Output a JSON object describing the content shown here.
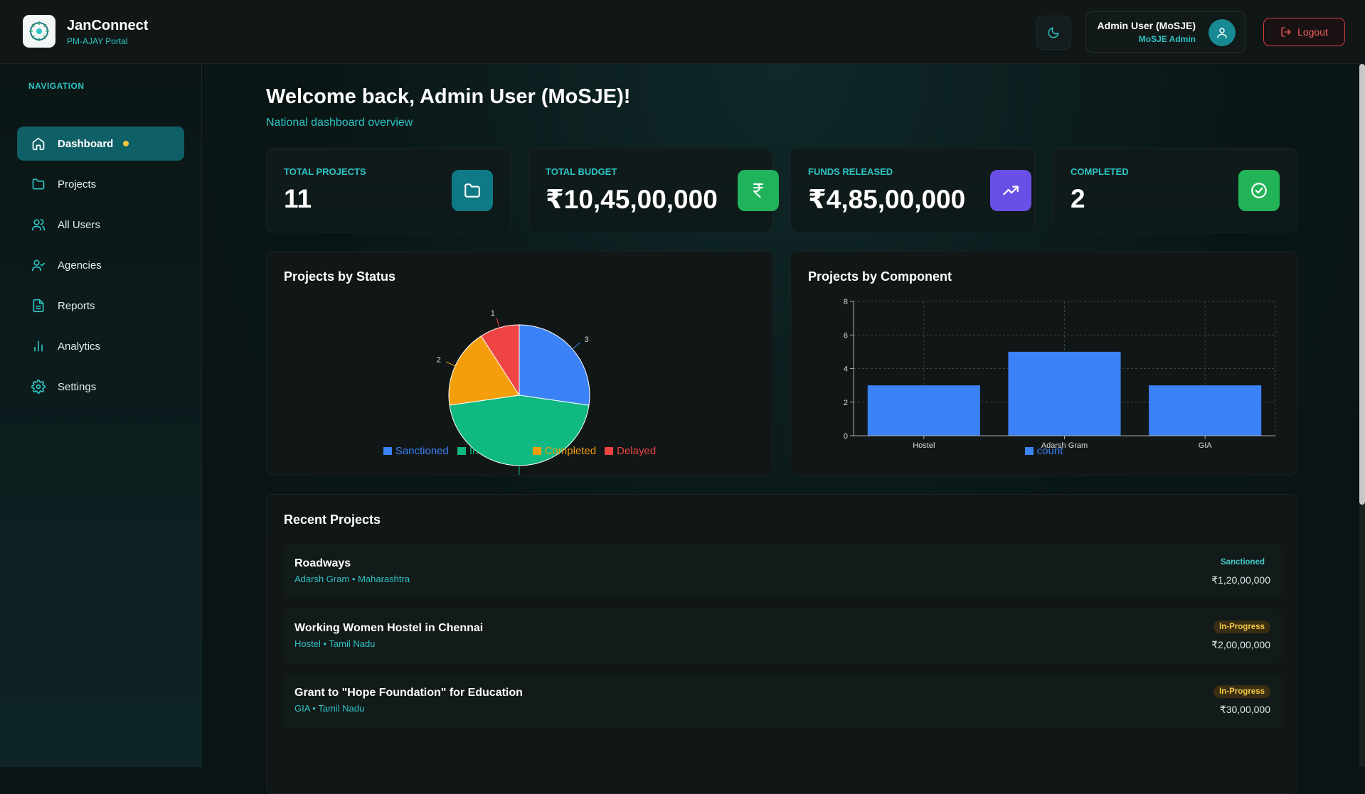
{
  "brand": {
    "name": "JanConnect",
    "subtitle": "PM-AJAY Portal",
    "logo_icon": "chakra-logo-icon"
  },
  "header": {
    "theme_icon": "moon-icon",
    "user_name": "Admin User (MoSJE)",
    "user_role": "MoSJE Admin",
    "avatar_icon": "user-icon",
    "logout_label": "Logout",
    "logout_icon": "logout-icon"
  },
  "sidebar": {
    "title": "NAVIGATION",
    "items": [
      {
        "label": "Dashboard",
        "icon": "home-icon",
        "active": true
      },
      {
        "label": "Projects",
        "icon": "folder-icon"
      },
      {
        "label": "All Users",
        "icon": "users-icon"
      },
      {
        "label": "Agencies",
        "icon": "user-check-icon"
      },
      {
        "label": "Reports",
        "icon": "file-text-icon"
      },
      {
        "label": "Analytics",
        "icon": "bar-chart-icon"
      },
      {
        "label": "Settings",
        "icon": "gear-icon"
      }
    ]
  },
  "page": {
    "title": "Welcome back, Admin User (MoSJE)!",
    "subtitle": "National dashboard overview"
  },
  "stats": [
    {
      "label": "TOTAL PROJECTS",
      "value": "11",
      "icon": "folder-icon",
      "color": "#0e7a86"
    },
    {
      "label": "TOTAL BUDGET",
      "value": "₹10,45,00,000",
      "icon": "rupee-icon",
      "color": "#21b35c"
    },
    {
      "label": "FUNDS RELEASED",
      "value": "₹4,85,00,000",
      "icon": "trending-up-icon",
      "color": "#6a4fe6"
    },
    {
      "label": "COMPLETED",
      "value": "2",
      "icon": "check-circle-icon",
      "color": "#22b357"
    }
  ],
  "charts": {
    "status_title": "Projects by Status",
    "component_title": "Projects by Component"
  },
  "chart_data": [
    {
      "type": "pie",
      "title": "Projects by Status",
      "categories": [
        "Sanctioned",
        "In Progress",
        "Completed",
        "Delayed"
      ],
      "values": [
        3,
        5,
        2,
        1
      ],
      "colors": [
        "#3b82f6",
        "#10b981",
        "#f59e0b",
        "#ef4444"
      ],
      "legend": "bottom"
    },
    {
      "type": "bar",
      "title": "Projects by Component",
      "categories": [
        "Hostel",
        "Adarsh Gram",
        "GIA"
      ],
      "series": [
        {
          "name": "count",
          "values": [
            3,
            5,
            3
          ]
        }
      ],
      "ylim": [
        0,
        8
      ],
      "yticks": [
        0,
        2,
        4,
        6,
        8
      ],
      "grid": true,
      "color": "#3b82f6",
      "legend": "bottom"
    }
  ],
  "recent": {
    "title": "Recent Projects",
    "items": [
      {
        "title": "Roadways",
        "meta": "Adarsh Gram • Maharashtra",
        "status": "Sanctioned",
        "amount": "₹1,20,00,000"
      },
      {
        "title": "Working Women Hostel in Chennai",
        "meta": "Hostel • Tamil Nadu",
        "status": "In-Progress",
        "amount": "₹2,00,00,000"
      },
      {
        "title": "Grant to \"Hope Foundation\" for Education",
        "meta": "GIA • Tamil Nadu",
        "status": "In-Progress",
        "amount": "₹30,00,000"
      }
    ]
  }
}
